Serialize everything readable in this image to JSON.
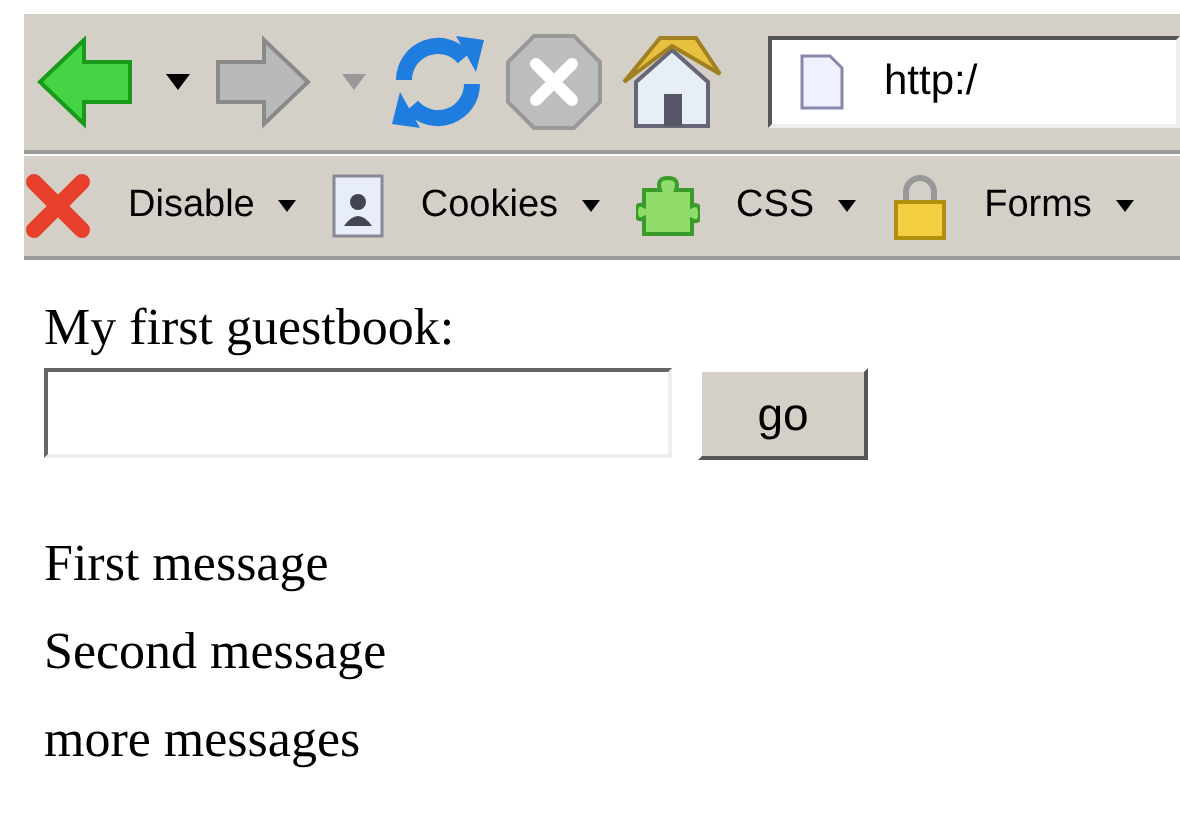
{
  "navigation_toolbar": {
    "buttons": [
      {
        "kind": "back",
        "disabled": false,
        "has_dropdown": true
      },
      {
        "kind": "forward",
        "disabled": true,
        "has_dropdown": true
      },
      {
        "kind": "reload",
        "disabled": false,
        "has_dropdown": false
      },
      {
        "kind": "stop",
        "disabled": true,
        "has_dropdown": false
      },
      {
        "kind": "home",
        "disabled": false,
        "has_dropdown": false
      }
    ],
    "address_bar": {
      "value": "http:/"
    }
  },
  "developer_toolbar": {
    "menus": [
      {
        "kind": "disable",
        "label": "Disable"
      },
      {
        "kind": "cookies",
        "label": "Cookies"
      },
      {
        "kind": "css",
        "label": "CSS"
      },
      {
        "kind": "forms",
        "label": "Forms"
      }
    ]
  },
  "page": {
    "heading": "My first guestbook:",
    "submit_button": "go",
    "messages": [
      "First message",
      "Second message",
      "more messages"
    ]
  }
}
